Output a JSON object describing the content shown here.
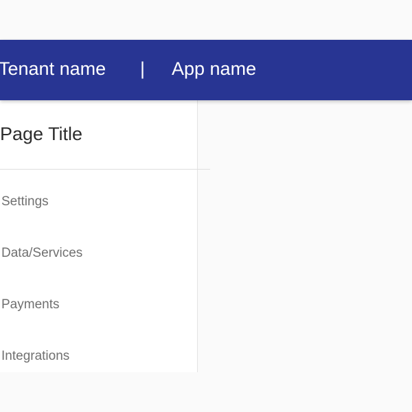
{
  "app_bar": {
    "tenant_name": "Tenant name",
    "separator": "|",
    "app_name": "App name",
    "background_color": "#283593",
    "text_color": "#ffffff"
  },
  "side_panel": {
    "page_title": "Page Title",
    "items": [
      {
        "label": "Settings"
      },
      {
        "label": "Data/Services"
      },
      {
        "label": "Payments"
      },
      {
        "label": "Integrations"
      }
    ]
  },
  "colors": {
    "page_background": "#fafafa",
    "panel_background": "#ffffff",
    "nav_text": "#707070",
    "title_text": "#2d2d2d"
  }
}
